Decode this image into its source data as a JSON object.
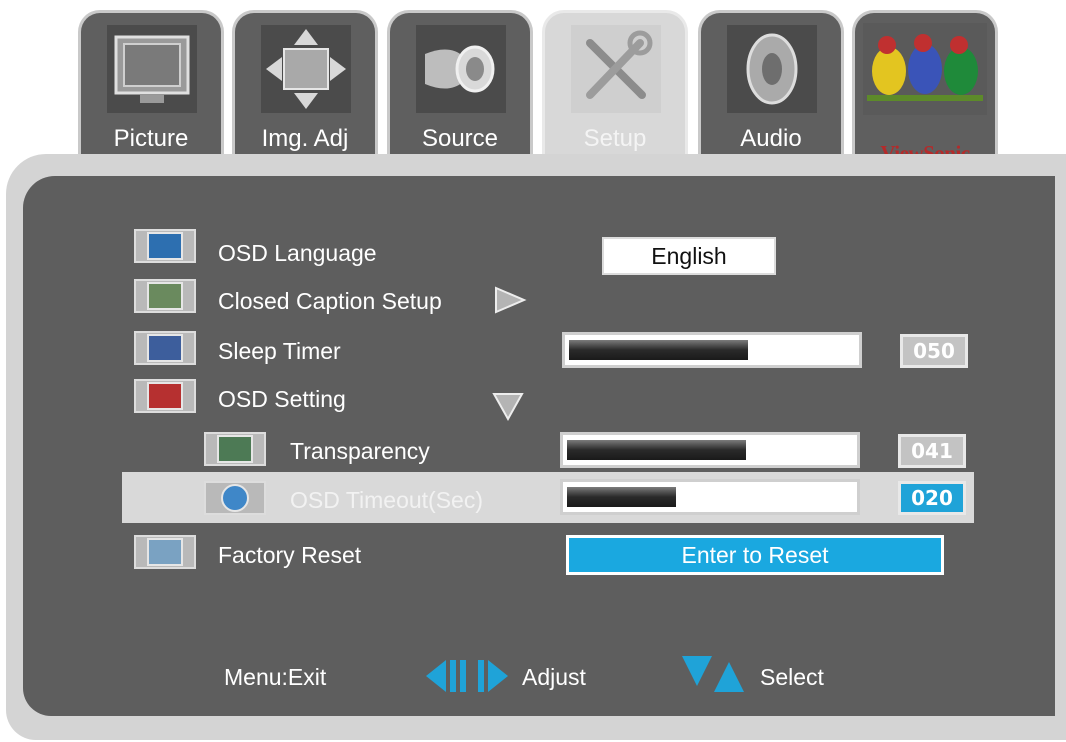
{
  "tabs": [
    {
      "label": "Picture",
      "icon": "tv-monitor-icon"
    },
    {
      "label": "Img. Adj",
      "icon": "image-adjust-icon"
    },
    {
      "label": "Source",
      "icon": "source-input-icon"
    },
    {
      "label": "Setup",
      "icon": "tools-icon",
      "active": true
    },
    {
      "label": "Audio",
      "icon": "speaker-icon"
    },
    {
      "brand": "ViewSonic",
      "icon": "birds-logo-icon"
    }
  ],
  "menu": {
    "osd_language": {
      "label": "OSD Language",
      "value": "English",
      "icon": "globe-map-icon"
    },
    "closed_caption": {
      "label": "Closed Caption Setup",
      "icon": "caption-icon"
    },
    "sleep_timer": {
      "label": "Sleep Timer",
      "value": "050",
      "level": 0.62,
      "icon": "zzz-icon"
    },
    "osd_setting": {
      "label": "OSD Setting",
      "icon": "osd-icon"
    },
    "transparency": {
      "label": "Transparency",
      "value": "041",
      "level": 0.62,
      "icon": "transparency-icon"
    },
    "osd_timeout": {
      "label": "OSD Timeout(Sec)",
      "value": "020",
      "level": 0.38,
      "icon": "timer-icon",
      "selected": true
    },
    "factory_reset": {
      "label": "Factory Reset",
      "button": "Enter to Reset",
      "icon": "reset-icon"
    }
  },
  "footer": {
    "exit": "Menu:Exit",
    "adjust": "Adjust",
    "select": "Select"
  },
  "colors": {
    "panel": "#5e5e5e",
    "highlight": "#d9d9d9",
    "accent": "#1aa8e0",
    "brand_red": "#b52a2a"
  }
}
